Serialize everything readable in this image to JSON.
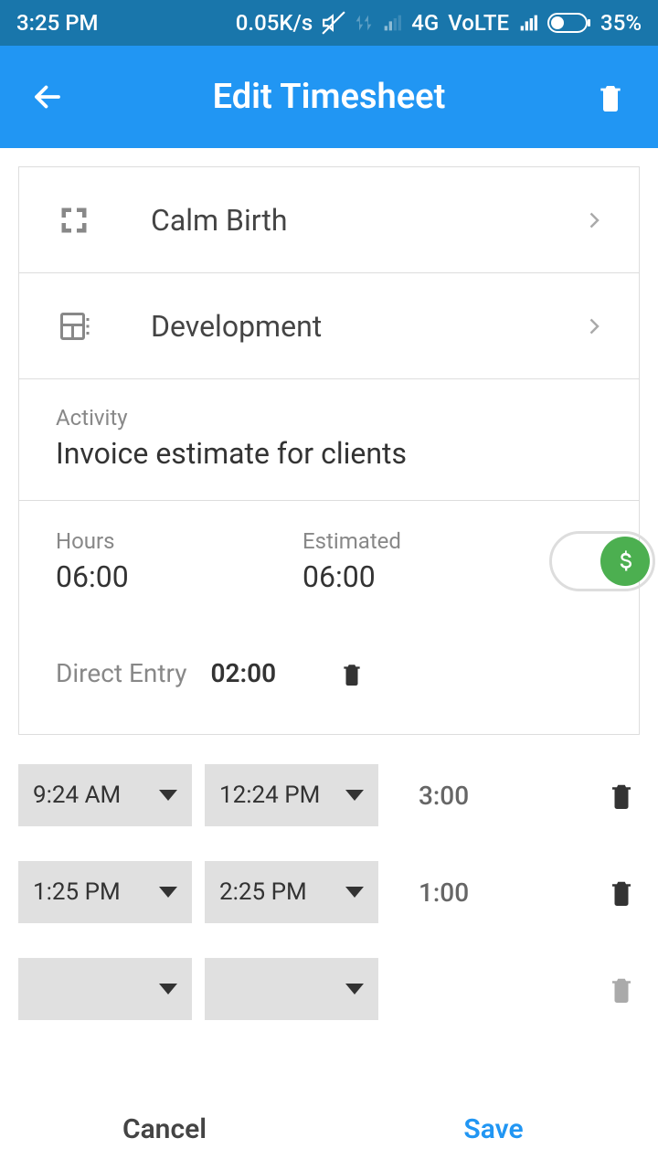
{
  "status": {
    "time": "3:25 PM",
    "speed": "0.05K/s",
    "net": "4G",
    "volte": "VoLTE",
    "battery": "35%"
  },
  "header": {
    "title": "Edit Timesheet"
  },
  "rows": {
    "project": "Calm Birth",
    "task": "Development"
  },
  "activity": {
    "label": "Activity",
    "value": "Invoice estimate for clients"
  },
  "hours": {
    "label": "Hours",
    "value": "06:00",
    "est_label": "Estimated",
    "est_value": "06:00"
  },
  "direct": {
    "label": "Direct Entry",
    "value": "02:00"
  },
  "entries": [
    {
      "start": "9:24 AM",
      "end": "12:24 PM",
      "dur": "3:00",
      "del": true
    },
    {
      "start": "1:25 PM",
      "end": "2:25 PM",
      "dur": "1:00",
      "del": true
    },
    {
      "start": "",
      "end": "",
      "dur": "",
      "del": false
    }
  ],
  "footer": {
    "cancel": "Cancel",
    "save": "Save"
  }
}
